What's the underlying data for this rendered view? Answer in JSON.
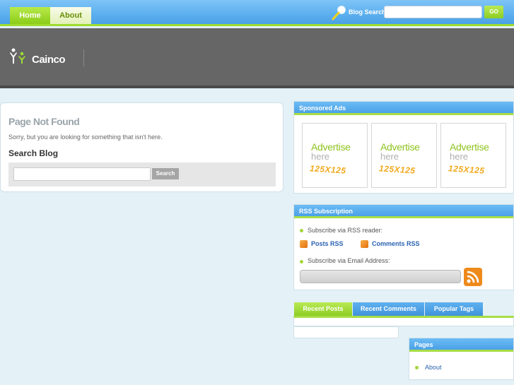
{
  "nav": {
    "home_label": "Home",
    "about_label": "About"
  },
  "top_search": {
    "label": "Blog Search",
    "go_label": "GO",
    "icon": "search-magnifier-icon"
  },
  "header": {
    "logo_text": "Cainco",
    "logo_icon": "people-logo-icon"
  },
  "main": {
    "title": "Page Not Found",
    "message": "Sorry, but you are looking for something that isn't here.",
    "search_title": "Search Blog",
    "search_button": "Search"
  },
  "sidebar": {
    "ads": {
      "title": "Sponsored Ads",
      "items": [
        {
          "line1": "Advertise",
          "line2": "here",
          "line3": "125X125"
        },
        {
          "line1": "Advertise",
          "line2": "here",
          "line3": "125X125"
        },
        {
          "line1": "Advertise",
          "line2": "here",
          "line3": "125X125"
        }
      ]
    },
    "rss": {
      "title": "RSS Subscription",
      "reader_text": "Subscribe via RSS reader:",
      "posts_link": "Posts RSS",
      "comments_link": "Comments RSS",
      "email_text": "Subscribe via Email Address:"
    },
    "tabs": {
      "recent_posts": "Recent Posts",
      "recent_comments": "Recent Comments",
      "popular_tags": "Popular Tags"
    },
    "pages": {
      "title": "Pages",
      "items": [
        "About"
      ]
    }
  },
  "colors": {
    "accent_green": "#9fdc2f",
    "accent_blue": "#4aa2e6",
    "header_gray": "#666666",
    "link_blue": "#2a62b0"
  }
}
